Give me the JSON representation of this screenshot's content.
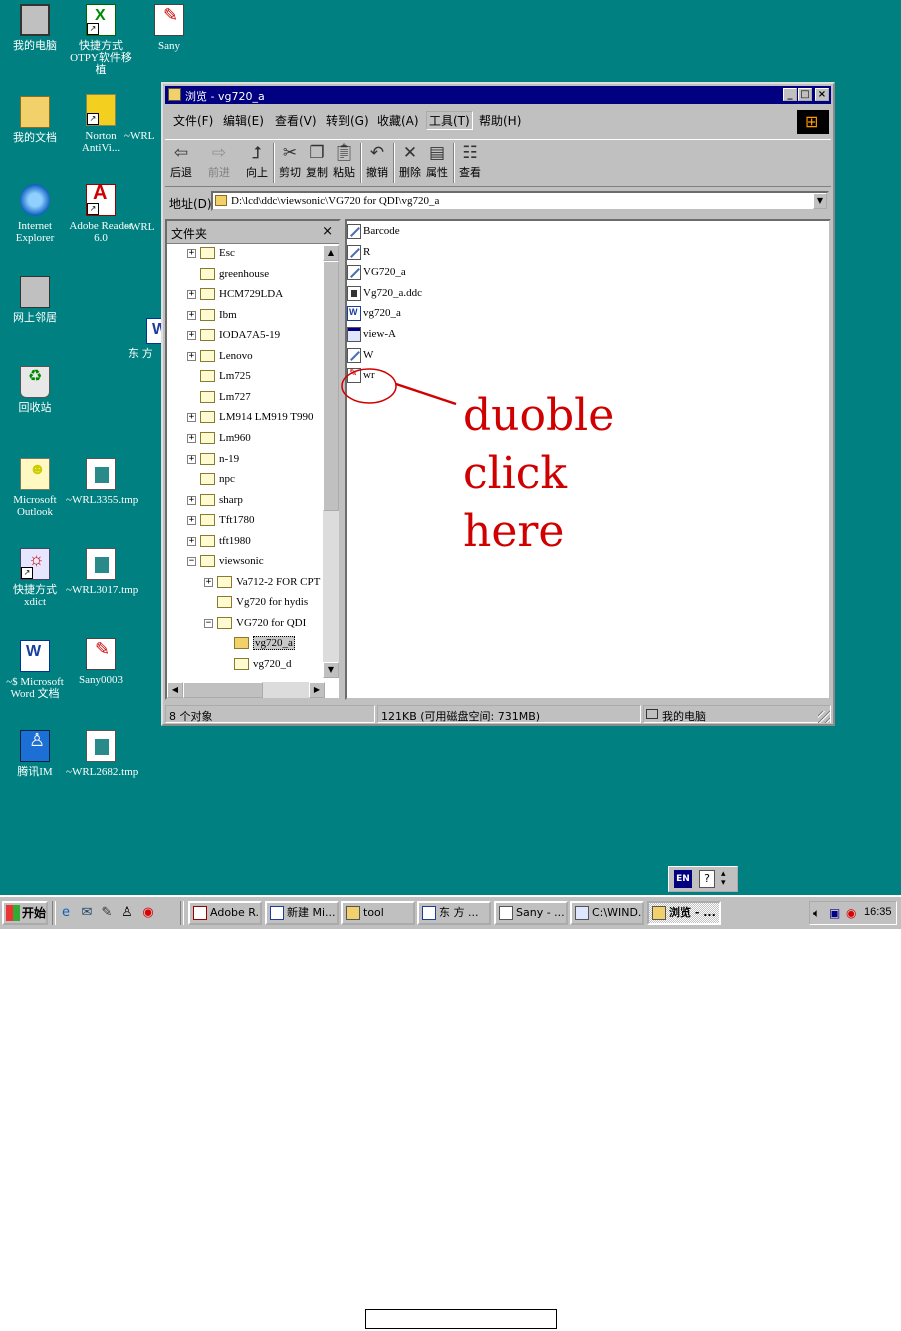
{
  "desktop_icons": {
    "my_computer": "我的电脑",
    "shortcut_otpy": "快捷方式\nOTPY软件移植",
    "sany": "Sany",
    "my_documents": "我的文档",
    "norton": "Norton\nAntiVi...",
    "wrl_partial_1": "~WRL",
    "ie": "Internet\nExplorer",
    "adobe": "Adobe Reader\n6.0",
    "wrl_partial_2": "~WRL",
    "network": "网上邻居",
    "dongfang_partial": "东 方",
    "recycle_bin": "回收站",
    "outlook": "Microsoft\nOutlook",
    "wrl3355": "~WRL3355.tmp",
    "shortcut_xdict": "快捷方式\nxdict",
    "wrl3017": "~WRL3017.tmp",
    "word_doc": "~$ Microsoft\nWord 文档",
    "sany0003": "Sany0003",
    "qq": "腾讯IM",
    "wrl2682": "~WRL2682.tmp"
  },
  "window": {
    "title": "浏览 - vg720_a",
    "menus": [
      "文件(F)",
      "编辑(E)",
      "查看(V)",
      "转到(G)",
      "收藏(A)",
      "工具(T)",
      "帮助(H)"
    ],
    "toolbar": {
      "back": "后退",
      "forward": "前进",
      "up": "向上",
      "cut": "剪切",
      "copy": "复制",
      "paste": "粘贴",
      "undo": "撤销",
      "delete": "删除",
      "properties": "属性",
      "views": "查看"
    },
    "address_label": "地址(D)",
    "address_value": "D:\\lcd\\ddc\\viewsonic\\VG720 for QDI\\vg720_a",
    "folders_label": "文件夹",
    "folders_close": "×",
    "tree": [
      "Esc",
      "greenhouse",
      "HCM729LDA",
      "Ibm",
      "IODA7A5-19",
      "Lenovo",
      "Lm725",
      "Lm727",
      "LM914 LM919 T990",
      "Lm960",
      "n-19",
      "npc",
      "sharp",
      "Tft1780",
      "tft1980",
      "viewsonic",
      "Va712-2 FOR CPT",
      "Vg720 for hydis",
      "VG720 for QDI",
      "vg720_a",
      "vg720_d"
    ],
    "files": [
      "Barcode",
      "R",
      "VG720_a",
      "Vg720_a.ddc",
      "vg720_a",
      "view-A",
      "W",
      "wr"
    ],
    "status": {
      "objects": "8 个对象",
      "size": "121KB (可用磁盘空间: 731MB)",
      "location": "我的电脑"
    }
  },
  "annotation": {
    "lines": [
      "duoble",
      "click",
      "here"
    ],
    "color": "#d00000"
  },
  "langbar": {
    "lang": "EN",
    "help": "?"
  },
  "taskbar": {
    "start": "开始",
    "buttons": [
      "Adobe R...",
      "新建 Mi...",
      "tool",
      "东 方 ...",
      "Sany - ...",
      "C:\\WIND...",
      "浏览 - ..."
    ],
    "clock": "16:35"
  }
}
